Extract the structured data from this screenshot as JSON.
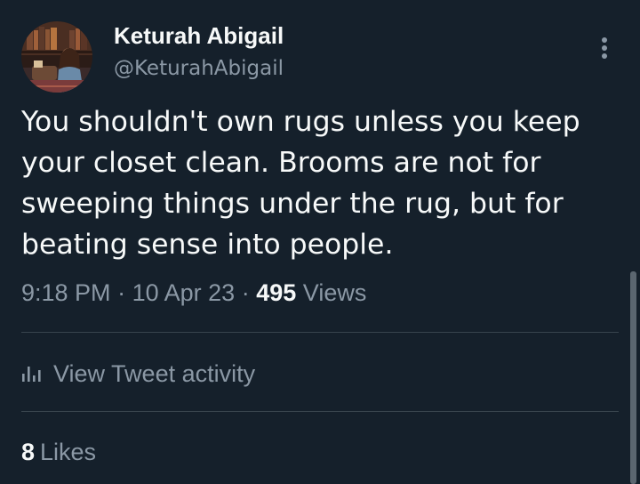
{
  "tweet": {
    "author": {
      "display_name": "Keturah Abigail",
      "handle": "@KeturahAbigail"
    },
    "text_lines": [
      "You shouldn't own rugs unless you keep",
      "your closet clean. Brooms are not for",
      "sweeping things under the rug, but for",
      "beating sense into people."
    ],
    "time": "9:18 PM",
    "separator": "·",
    "date": "10 Apr 23",
    "views_count": "495",
    "views_label": "Views",
    "activity_label": "View Tweet activity",
    "likes_count": "8",
    "likes_label": "Likes"
  },
  "colors": {
    "background": "#15202b",
    "text_primary": "#f7f9f9",
    "text_secondary": "#8b98a5",
    "divider": "#38444d"
  },
  "icons": {
    "more": "more-vertical-icon",
    "activity": "bar-chart-icon"
  }
}
